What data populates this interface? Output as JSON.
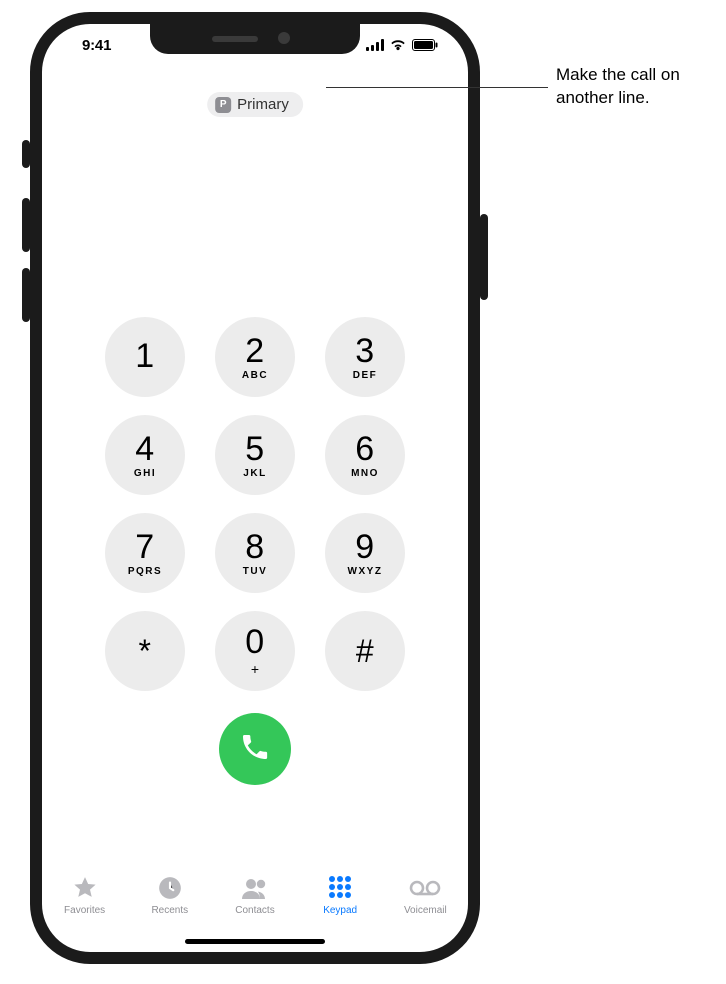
{
  "status": {
    "time": "9:41"
  },
  "line_selector": {
    "badge": "P",
    "label": "Primary"
  },
  "keys": [
    [
      {
        "d": "1",
        "l": ""
      },
      {
        "d": "2",
        "l": "ABC"
      },
      {
        "d": "3",
        "l": "DEF"
      }
    ],
    [
      {
        "d": "4",
        "l": "GHI"
      },
      {
        "d": "5",
        "l": "JKL"
      },
      {
        "d": "6",
        "l": "MNO"
      }
    ],
    [
      {
        "d": "7",
        "l": "PQRS"
      },
      {
        "d": "8",
        "l": "TUV"
      },
      {
        "d": "9",
        "l": "WXYZ"
      }
    ],
    [
      {
        "d": "*",
        "l": ""
      },
      {
        "d": "0",
        "l": "+"
      },
      {
        "d": "#",
        "l": ""
      }
    ]
  ],
  "tabs": {
    "favorites": "Favorites",
    "recents": "Recents",
    "contacts": "Contacts",
    "keypad": "Keypad",
    "voicemail": "Voicemail"
  },
  "callout": "Make the call on another line."
}
